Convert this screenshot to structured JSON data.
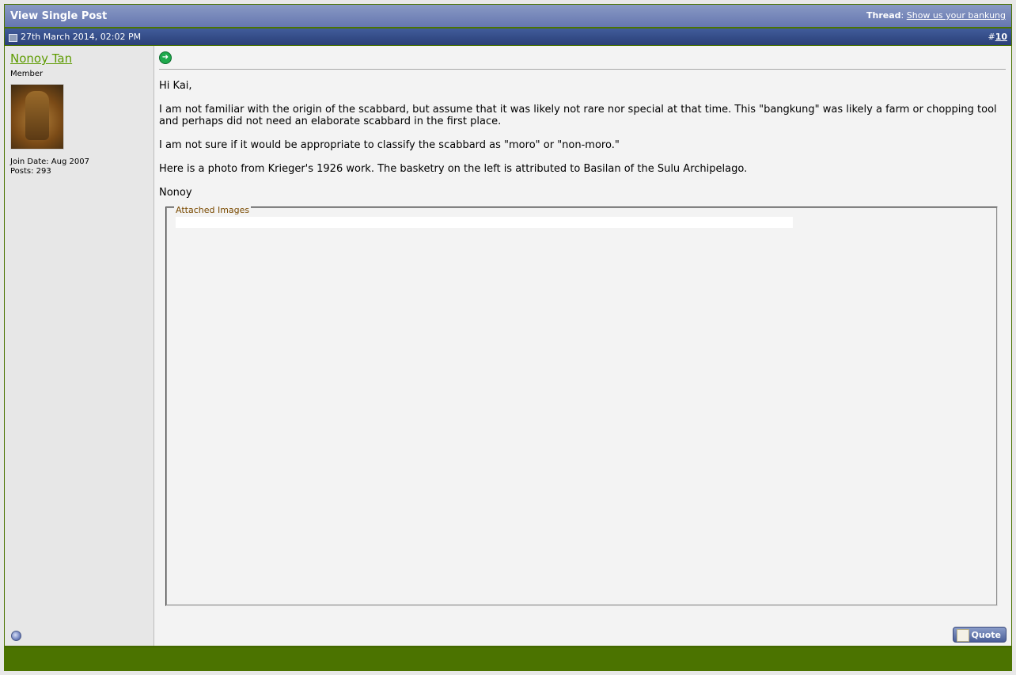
{
  "header": {
    "title": "View Single Post",
    "thread_label": "Thread",
    "thread_sep": ": ",
    "thread_link": "Show us your bankung"
  },
  "post": {
    "date": "27th March 2014, 02:02 PM",
    "number_prefix": "#",
    "number": "10"
  },
  "user": {
    "name": "Nonoy Tan",
    "title": "Member",
    "join_date": "Join Date: Aug 2007",
    "posts": "Posts: 293"
  },
  "message": {
    "paragraphs": [
      "Hi Kai,",
      "I am not familiar with the origin of the scabbard, but assume that it was likely not rare nor special at that time. This \"bangkung\" was likely a farm or chopping tool and perhaps did not need an elaborate scabbard in the first place.",
      "I am not sure if it would be appropriate to classify the scabbard as \"moro\" or \"non-moro.\"",
      "Here is a photo from Krieger's 1926 work. The basketry on the left is attributed to Basilan of the Sulu Archipelago.",
      "Nonoy"
    ]
  },
  "attachments": {
    "legend": "Attached Images"
  },
  "actions": {
    "quote_label": "Quote"
  },
  "colors": {
    "accent": "#4b7300",
    "header": "#2a3f77",
    "username": "#5d9b00"
  }
}
